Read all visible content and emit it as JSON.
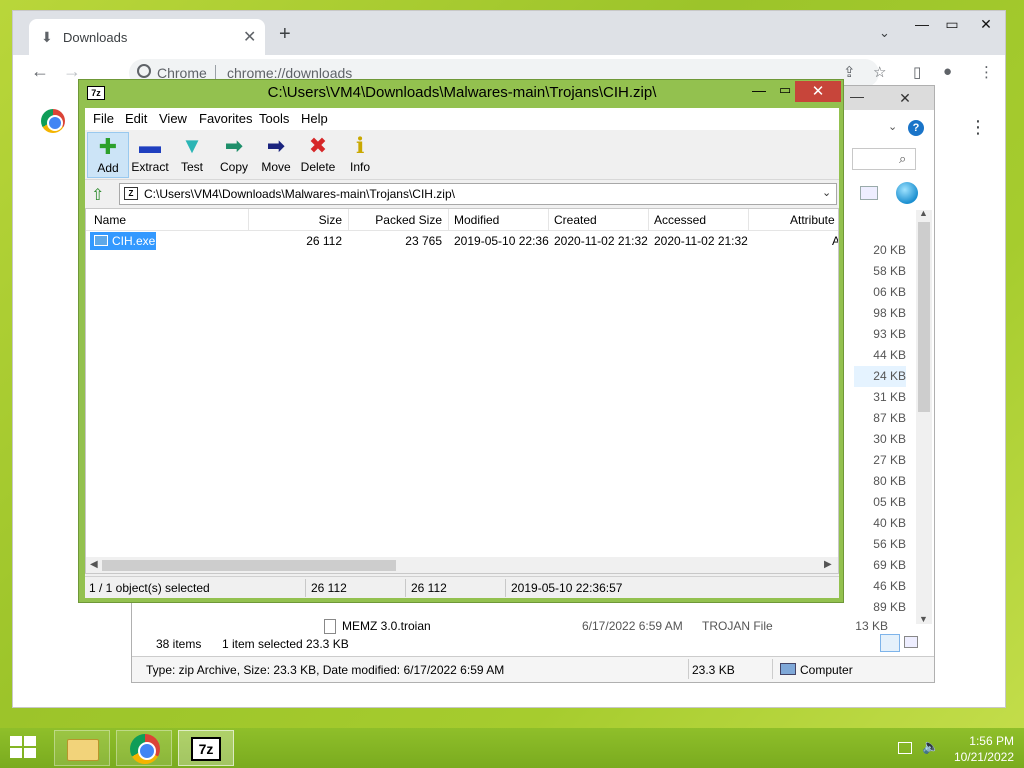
{
  "chrome": {
    "tab_title": "Downloads",
    "tab_close": "✕",
    "new_tab": "+",
    "omnibox_site": "Chrome",
    "omnibox_url": "chrome://downloads",
    "icons": [
      "download-icon",
      "back-arrow-icon",
      "forward-arrow-icon",
      "share-icon",
      "star-icon",
      "sidebar-icon",
      "profile-icon",
      "kebab-menu-icon",
      "chrome-logo-icon"
    ]
  },
  "explorer": {
    "sizes": [
      "20 KB",
      "58 KB",
      "06 KB",
      "98 KB",
      "93 KB",
      "44 KB",
      "24 KB",
      "31 KB",
      "87 KB",
      "30 KB",
      "27 KB",
      "80 KB",
      "05 KB",
      "40 KB",
      "56 KB",
      "69 KB",
      "46 KB",
      "89 KB"
    ],
    "memz_row": {
      "name": "MEMZ 3.0.troian",
      "date": "6/17/2022 6:59 AM",
      "type": "TROJAN File",
      "size": "13 KB"
    },
    "status": {
      "item_count": "38 items",
      "selected": "1 item selected",
      "selected_size": "23.3 KB"
    },
    "details": {
      "info": "Type: zip Archive, Size: 23.3 KB, Date modified: 6/17/2022 6:59 AM",
      "size": "23.3 KB",
      "location": "Computer"
    }
  },
  "sevenzip": {
    "title": "C:\\Users\\VM4\\Downloads\\Malwares-main\\Trojans\\CIH.zip\\",
    "app_icon": "7z",
    "menu": [
      "File",
      "Edit",
      "View",
      "Favorites",
      "Tools",
      "Help"
    ],
    "toolbar": [
      {
        "label": "Add",
        "icon": "add-icon",
        "glyph": "✚",
        "color": "#2ca02c"
      },
      {
        "label": "Extract",
        "icon": "extract-icon",
        "glyph": "▬",
        "color": "#1f3fbf"
      },
      {
        "label": "Test",
        "icon": "test-icon",
        "glyph": "▼",
        "color": "#2bb5b5"
      },
      {
        "label": "Copy",
        "icon": "copy-icon",
        "glyph": "➡",
        "color": "#1e8f6a"
      },
      {
        "label": "Move",
        "icon": "move-icon",
        "glyph": "➡",
        "color": "#1a237e"
      },
      {
        "label": "Delete",
        "icon": "delete-icon",
        "glyph": "✖",
        "color": "#d62728"
      },
      {
        "label": "Info",
        "icon": "info-icon",
        "glyph": "ℹ",
        "color": "#c9a800"
      }
    ],
    "path": "C:\\Users\\VM4\\Downloads\\Malwares-main\\Trojans\\CIH.zip\\",
    "columns": [
      "Name",
      "Size",
      "Packed Size",
      "Modified",
      "Created",
      "Accessed",
      "Attribute"
    ],
    "files": [
      {
        "name": "CIH.exe",
        "size": "26 112",
        "packed": "23 765",
        "modified": "2019-05-10 22:36",
        "created": "2020-11-02 21:32",
        "accessed": "2020-11-02 21:32",
        "attributes": "A"
      }
    ],
    "status": {
      "selection": "1 / 1 object(s) selected",
      "size": "26 112",
      "packed": "26 112",
      "modified": "2019-05-10 22:36:57"
    }
  },
  "taskbar": {
    "seven_zip_label": "7z",
    "time": "1:56 PM",
    "date": "10/21/2022"
  },
  "colors": {
    "desktop_green": "#a6cc2e",
    "sevenzip_frame": "#93c14f",
    "close_red": "#c7453a",
    "selection_blue": "#3399ff"
  }
}
